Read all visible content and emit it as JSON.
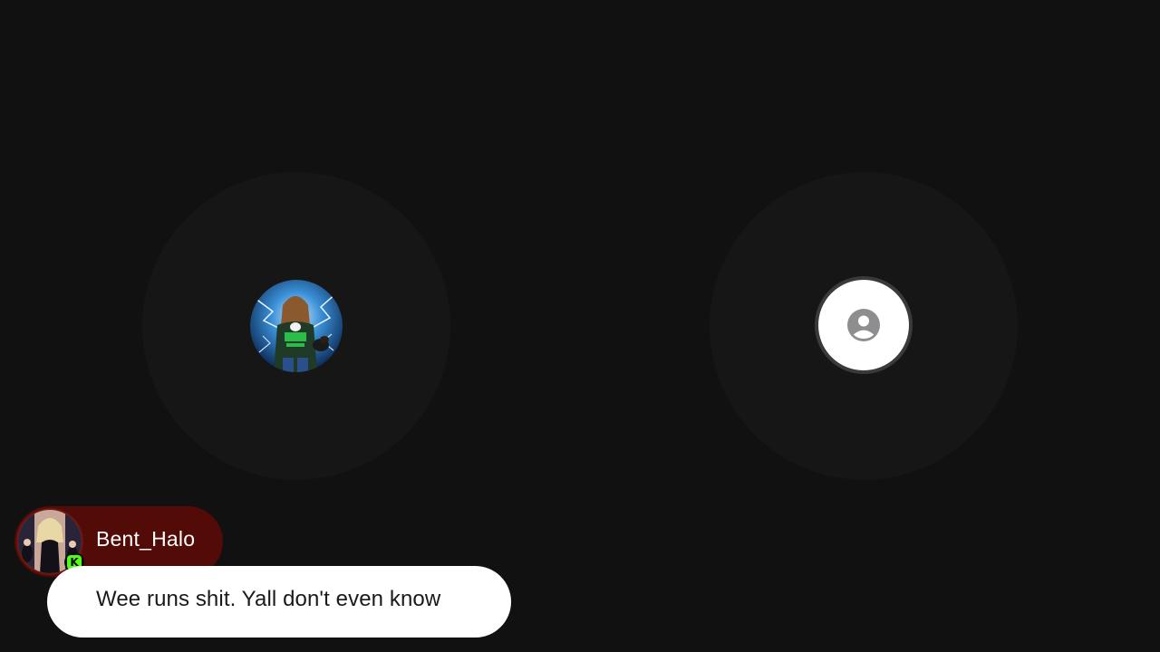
{
  "participants": [
    {
      "position": "left",
      "avatar": "profile-photo",
      "avatar_icon": "user-photo-icon"
    },
    {
      "position": "right",
      "avatar": "default",
      "avatar_icon": "user-circle-icon"
    }
  ],
  "chat_overlay": {
    "username": "Bent_Halo",
    "platform_badge": "K",
    "platform_badge_color": "#53fc18",
    "name_pill_color": "#520b06",
    "message": "Wee runs shit. Yall don't even know"
  },
  "colors": {
    "background": "#111112",
    "ring": "#161617",
    "bubble": "#ffffff"
  }
}
